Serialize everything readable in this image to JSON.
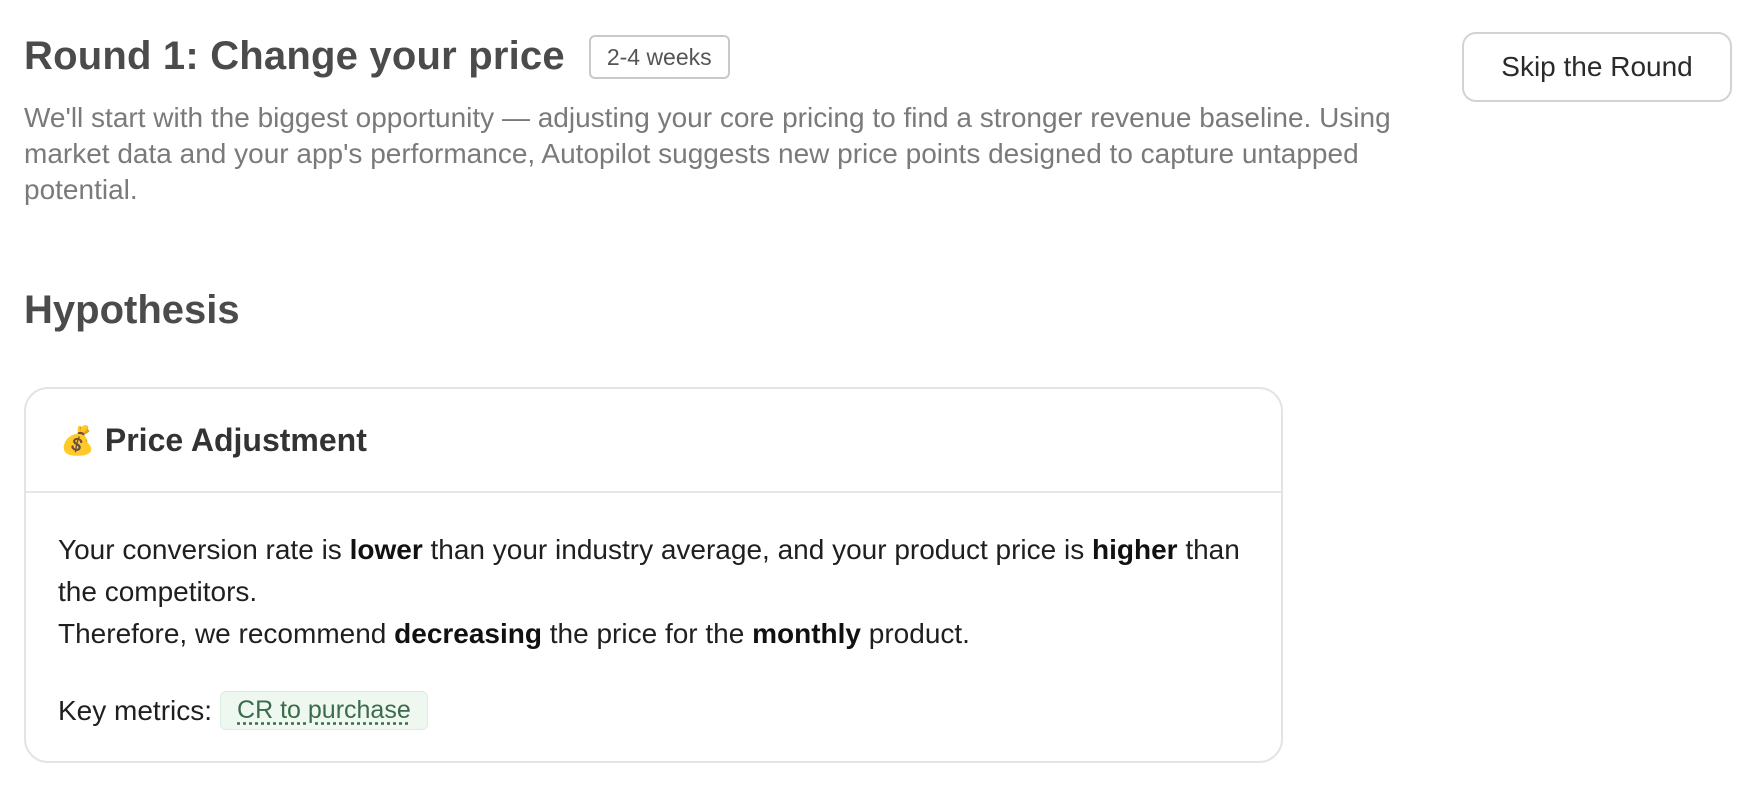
{
  "header": {
    "title": "Round 1: Change your price",
    "duration": "2-4 weeks",
    "skip_label": "Skip the Round"
  },
  "description": "We'll start with the biggest opportunity — adjusting your core pricing to find a stronger revenue baseline. Using market data and your app's performance, Autopilot suggests new price points designed to capture untapped potential.",
  "section": {
    "heading": "Hypothesis"
  },
  "card": {
    "icon": "money-bag-icon",
    "icon_glyph": "💰",
    "title": "Price Adjustment",
    "line1": {
      "t1": "Your conversion rate is ",
      "b1": "lower",
      "t2": " than your industry average, and your product price is ",
      "b2": "higher",
      "t3": " than the competitors."
    },
    "line2": {
      "t1": "Therefore, we recommend ",
      "b1": "decreasing",
      "t2": " the price for the ",
      "b2": "monthly",
      "t3": " product."
    },
    "metrics_label": "Key metrics:",
    "metrics": [
      "CR to purchase"
    ]
  }
}
